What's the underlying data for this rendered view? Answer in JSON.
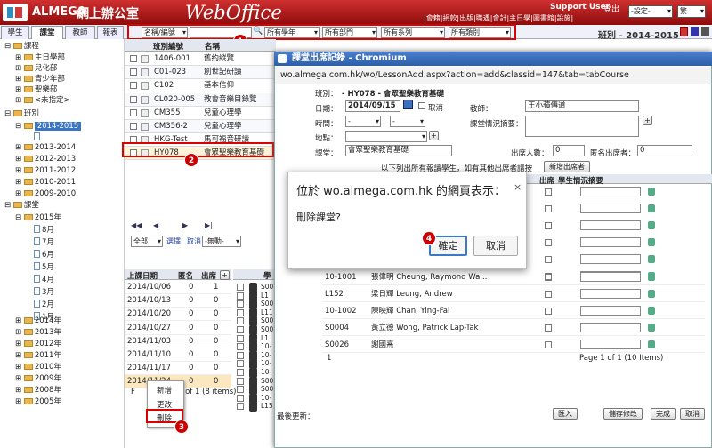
{
  "header": {
    "brand": "ALMEGA",
    "brand_cn": "網上辦公室",
    "product": "WebOffice",
    "support": "Support User",
    "logout": "登出",
    "links": "|會籍|捐款|出版|職遇|會計|主日學|圖書館|設施|",
    "settings": "-設定-",
    "lang": "繁"
  },
  "tabs": [
    "學生",
    "課堂",
    "教師",
    "報表"
  ],
  "toolbar": {
    "filter1": "名稱/編號",
    "filter2": "所有學年",
    "filter3": "所有部門",
    "filter4": "所有系列",
    "filter5": "所有類別",
    "class_label": "班別 - 2014-2015"
  },
  "callouts": [
    "1",
    "2",
    "3",
    "4"
  ],
  "tree": {
    "courses": "課程",
    "courses_items": [
      "主日學部",
      "兒化部",
      "青少年部",
      "聖樂部",
      "<未指定>"
    ],
    "classes": "班別",
    "class_years": [
      "2014-2015",
      "2013-2014",
      "2012-2013",
      "2011-2012",
      "2010-2011",
      "2009-2010"
    ],
    "lessons": "課堂",
    "lesson_year": "2015年",
    "months": [
      "8月",
      "7月",
      "6月",
      "5月",
      "4月",
      "3月",
      "2月",
      "1月"
    ],
    "older_years": [
      "2014年",
      "2013年",
      "2012年",
      "2011年",
      "2010年",
      "2009年",
      "2008年",
      "2005年"
    ]
  },
  "list": {
    "headers": [
      "班別編號",
      "名稱"
    ],
    "rows": [
      [
        "1406-001",
        "舊約縱覽"
      ],
      [
        "C01-023",
        "創世記研讀"
      ],
      [
        "C102",
        "基本信仰"
      ],
      [
        "CL020-005",
        "教會音樂目錄覽"
      ],
      [
        "CM355",
        "兒童心理學"
      ],
      [
        "CM356-2",
        "兒童心理學"
      ],
      [
        "HKG-Test",
        "馬可福音研讀"
      ],
      [
        "HY078",
        "會眾聖樂教育基礎"
      ]
    ],
    "nav": [
      "◀◀",
      "◀",
      "▶",
      "▶|"
    ],
    "select_all": "全部",
    "select_label": "選擇",
    "cancel_label": "取消",
    "action": "-無動-"
  },
  "lessons": {
    "headers": [
      "上課日期",
      "匿名",
      "出席"
    ],
    "rows": [
      [
        "2014/10/06",
        "0",
        "1"
      ],
      [
        "2014/10/13",
        "0",
        "0"
      ],
      [
        "2014/10/20",
        "0",
        "0"
      ],
      [
        "2014/10/27",
        "0",
        "0"
      ],
      [
        "2014/11/03",
        "0",
        "0"
      ],
      [
        "2014/11/10",
        "0",
        "0"
      ],
      [
        "2014/11/17",
        "0",
        "0"
      ],
      [
        "2014/11/24",
        "0",
        "0"
      ]
    ],
    "pager": "1 of 1 (8 items)",
    "context_menu": [
      "新增",
      "更改",
      "刪除"
    ]
  },
  "students": {
    "codes": [
      "S00",
      "L1",
      "S00",
      "L11",
      "S00",
      "S00",
      "L1",
      "10-",
      "10-",
      "10-",
      "10-",
      "S00",
      "S00",
      "10-",
      "L15"
    ]
  },
  "dialog": {
    "title": "課堂出席記錄 - Chromium",
    "url": "wo.almega.com.hk/wo/LessonAdd.aspx?action=add&classid=147&tab=tabCourse",
    "class_label": "班別：",
    "class_value": "- HY078 - 會眾聖樂教育基礎",
    "date_label": "日期：",
    "date_value": "2014/09/15",
    "cancel_chk": "取消",
    "teacher_label": "教師：",
    "teacher_value": "王小蘋傳道",
    "time_label": "時間：",
    "time_from": "-",
    "time_to": "-",
    "summary_label": "課堂情況摘要：",
    "place_label": "地點：",
    "lesson_label": "課堂：",
    "lesson_value": "會眾聖樂教育基礎",
    "attend_label": "出席人數：",
    "attend_value": "0",
    "anon_label": "匿名出席者：",
    "anon_value": "0",
    "note": "以下列出所有報讀學生，如有其他出席者請按",
    "add_btn": "新增出席者",
    "col_attend": "出席",
    "col_summary": "學生情況摘要",
    "students": [
      [
        "10-1001",
        "張偉明 Cheung, Raymond Wa..."
      ],
      [
        "L152",
        "梁日輝 Leung, Andrew"
      ],
      [
        "10-1002",
        "陳映輝 Chan, Ying-Fai"
      ],
      [
        "S0004",
        "黃立德 Wong, Patrick Lap-Tak"
      ],
      [
        "S0026",
        "謝國熹"
      ]
    ],
    "footer_num": "1",
    "pager": "Page 1 of 1 (10 Items)",
    "last_update": "最後更新：",
    "btn_import": "匯入",
    "btn_save": "儲存修改",
    "btn_done": "完成",
    "btn_cancel": "取消"
  },
  "alert": {
    "title": "位於 wo.almega.com.hk 的網頁表示：",
    "message": "刪除課堂?",
    "ok": "確定",
    "cancel": "取消",
    "close": "×"
  }
}
